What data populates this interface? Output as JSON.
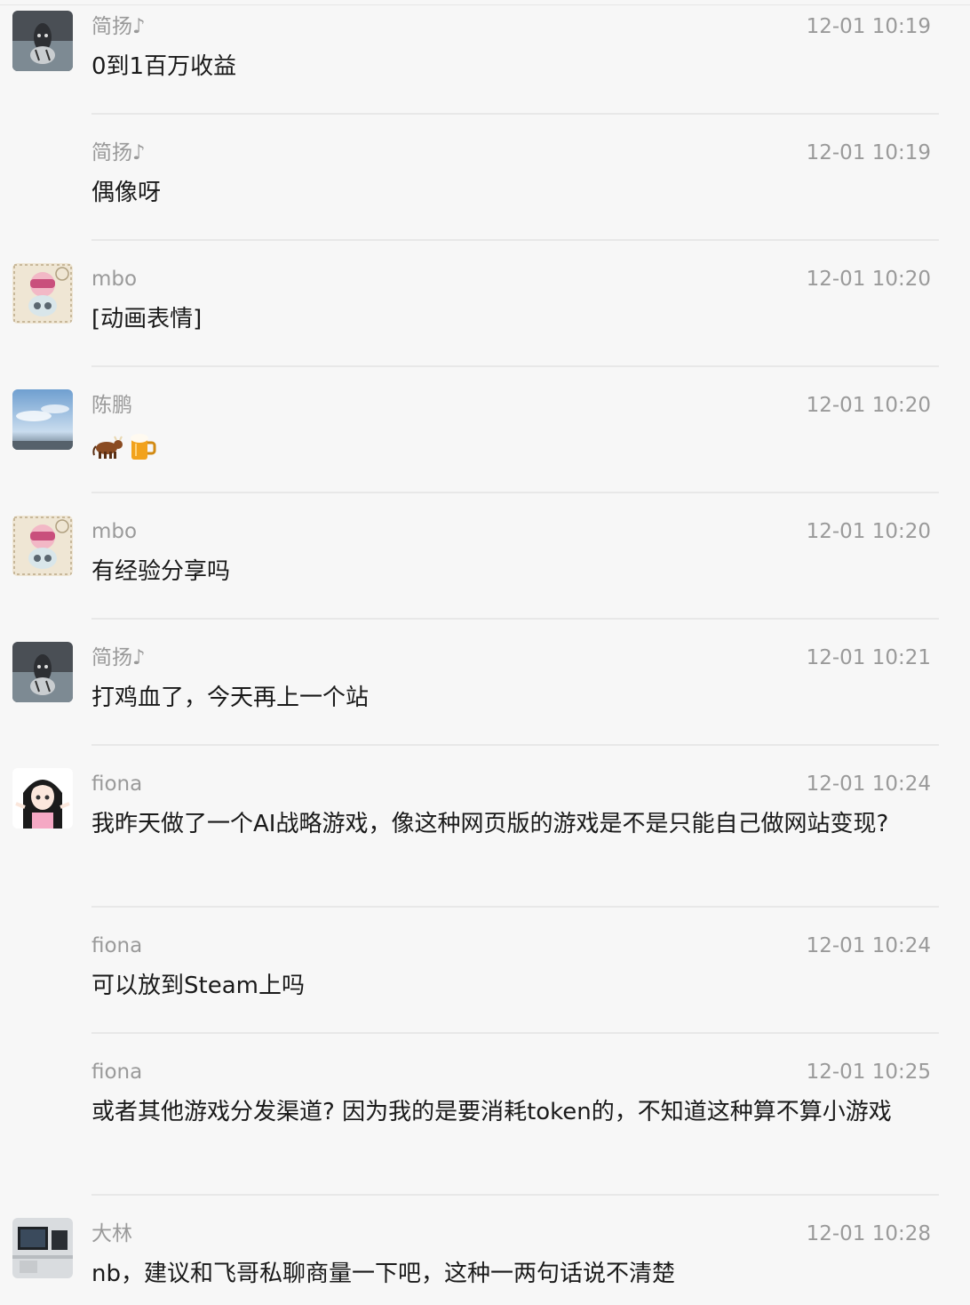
{
  "messages": [
    {
      "sender": "简扬♪",
      "time": "12-01 10:19",
      "text": "0到1百万收益",
      "avatar": "tiger-cat-avatar"
    },
    {
      "sender": "简扬♪",
      "time": "12-01 10:19",
      "text": "偶像呀",
      "avatar": ""
    },
    {
      "sender": "mbo",
      "time": "12-01 10:20",
      "text": "[动画表情]",
      "avatar": "bear-stamp-avatar"
    },
    {
      "sender": "陈鹏",
      "time": "12-01 10:20",
      "text": "",
      "avatar": "sky-avatar",
      "emojis": [
        "cow-emoji",
        "beer-emoji"
      ]
    },
    {
      "sender": "mbo",
      "time": "12-01 10:20",
      "text": "有经验分享吗",
      "avatar": "bear-stamp-avatar"
    },
    {
      "sender": "简扬♪",
      "time": "12-01 10:21",
      "text": "打鸡血了，今天再上一个站",
      "avatar": "tiger-cat-avatar"
    },
    {
      "sender": "fiona",
      "time": "12-01 10:24",
      "text": "我昨天做了一个AI战略游戏，像这种网页版的游戏是不是只能自己做网站变现?",
      "avatar": "anime-girl-avatar"
    },
    {
      "sender": "fiona",
      "time": "12-01 10:24",
      "text": "可以放到Steam上吗",
      "avatar": ""
    },
    {
      "sender": "fiona",
      "time": "12-01 10:25",
      "text": "或者其他游戏分发渠道? 因为我的是要消耗token的，不知道这种算不算小游戏",
      "avatar": ""
    },
    {
      "sender": "大林",
      "time": "12-01 10:28",
      "text": "nb，建议和飞哥私聊商量一下吧，这种一两句话说不清楚",
      "avatar": "desk-avatar"
    }
  ]
}
